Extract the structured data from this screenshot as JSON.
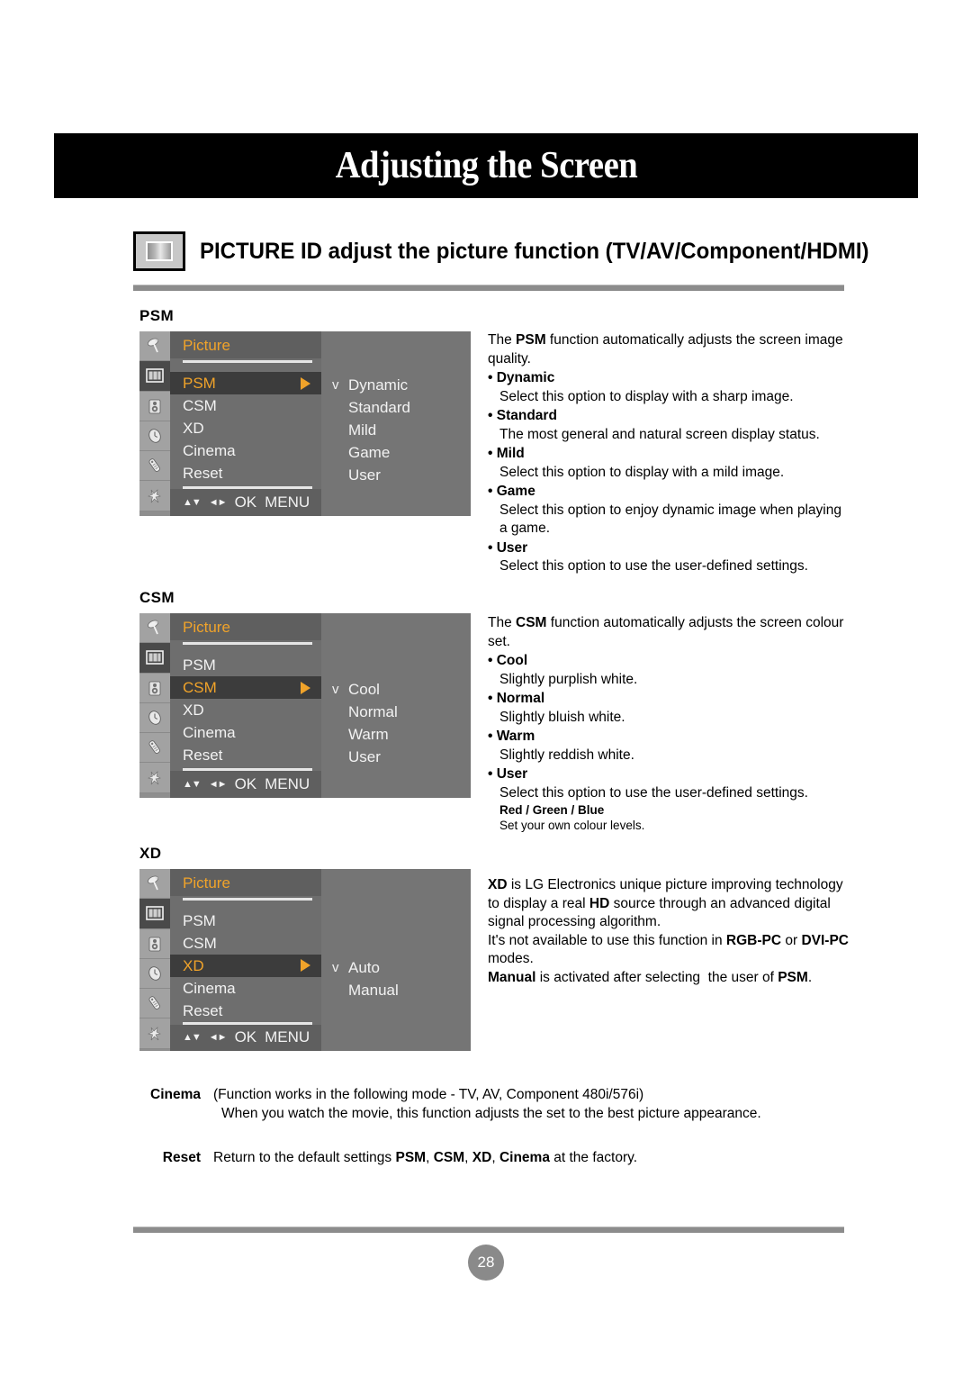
{
  "banner": {
    "title": "Adjusting the Screen"
  },
  "section": {
    "icon": "picture-screen-icon",
    "heading": "PICTURE ID adjust the picture function (TV/AV/Component/HDMI)"
  },
  "osd_common": {
    "title": "Picture",
    "menu_items": [
      "PSM",
      "CSM",
      "XD",
      "Cinema",
      "Reset"
    ],
    "footer": {
      "updown": "▲▼",
      "leftright": "◄►",
      "ok": "OK",
      "menu": "MENU"
    },
    "sidebar_icons": [
      "antenna-icon",
      "picture-icon",
      "sound-icon",
      "time-icon",
      "option-icon",
      "setup-icon"
    ],
    "check_glyph": "v",
    "accent_color": "#f0a32a"
  },
  "blocks": [
    {
      "label": "PSM",
      "selected_item": "PSM",
      "options": [
        "Dynamic",
        "Standard",
        "Mild",
        "Game",
        "User"
      ],
      "checked_option": "Dynamic",
      "intro": "The PSM function automatically adjusts the screen image quality.",
      "intro_bold": "PSM",
      "bullets": [
        {
          "term": "Dynamic",
          "desc": "Select this option to display with a sharp image."
        },
        {
          "term": "Standard",
          "desc": "The most general and natural screen display status."
        },
        {
          "term": "Mild",
          "desc": "Select this option to display with a mild image."
        },
        {
          "term": "Game",
          "desc": "Select this option to enjoy dynamic image when playing a game."
        },
        {
          "term": "User",
          "desc": "Select this option to use the user-defined settings."
        }
      ]
    },
    {
      "label": "CSM",
      "selected_item": "CSM",
      "options": [
        "Cool",
        "Normal",
        "Warm",
        "User"
      ],
      "checked_option": "Cool",
      "intro": "The CSM function automatically adjusts the screen colour set.",
      "intro_bold": "CSM",
      "bullets": [
        {
          "term": "Cool",
          "desc": "Slightly purplish white."
        },
        {
          "term": "Normal",
          "desc": "Slightly bluish white."
        },
        {
          "term": "Warm",
          "desc": "Slightly reddish white."
        },
        {
          "term": "User",
          "desc": "Select this option to use the user-defined settings."
        }
      ],
      "sub_note_title": "Red / Green / Blue",
      "sub_note_text": "Set your own colour levels."
    },
    {
      "label": "XD",
      "selected_item": "XD",
      "options": [
        "Auto",
        "Manual"
      ],
      "checked_option": "Auto",
      "paragraphs": [
        "XD is LG Electronics unique picture improving technology to display a real HD source through an advanced digital signal processing algorithm.",
        "It's not available to use this function in RGB-PC or DVI-PC modes.",
        "Manual is activated after selecting  the user of PSM."
      ]
    }
  ],
  "notes": [
    {
      "key": "Cinema",
      "line1": "(Function works in the following mode - TV, AV, Component 480i/576i)",
      "line2": "When you watch the movie, this function adjusts the set to the best picture appearance."
    },
    {
      "key": "Reset",
      "line1": "Return to the default settings PSM, CSM, XD, Cinema at the factory."
    }
  ],
  "footer": {
    "page_number": "28"
  }
}
